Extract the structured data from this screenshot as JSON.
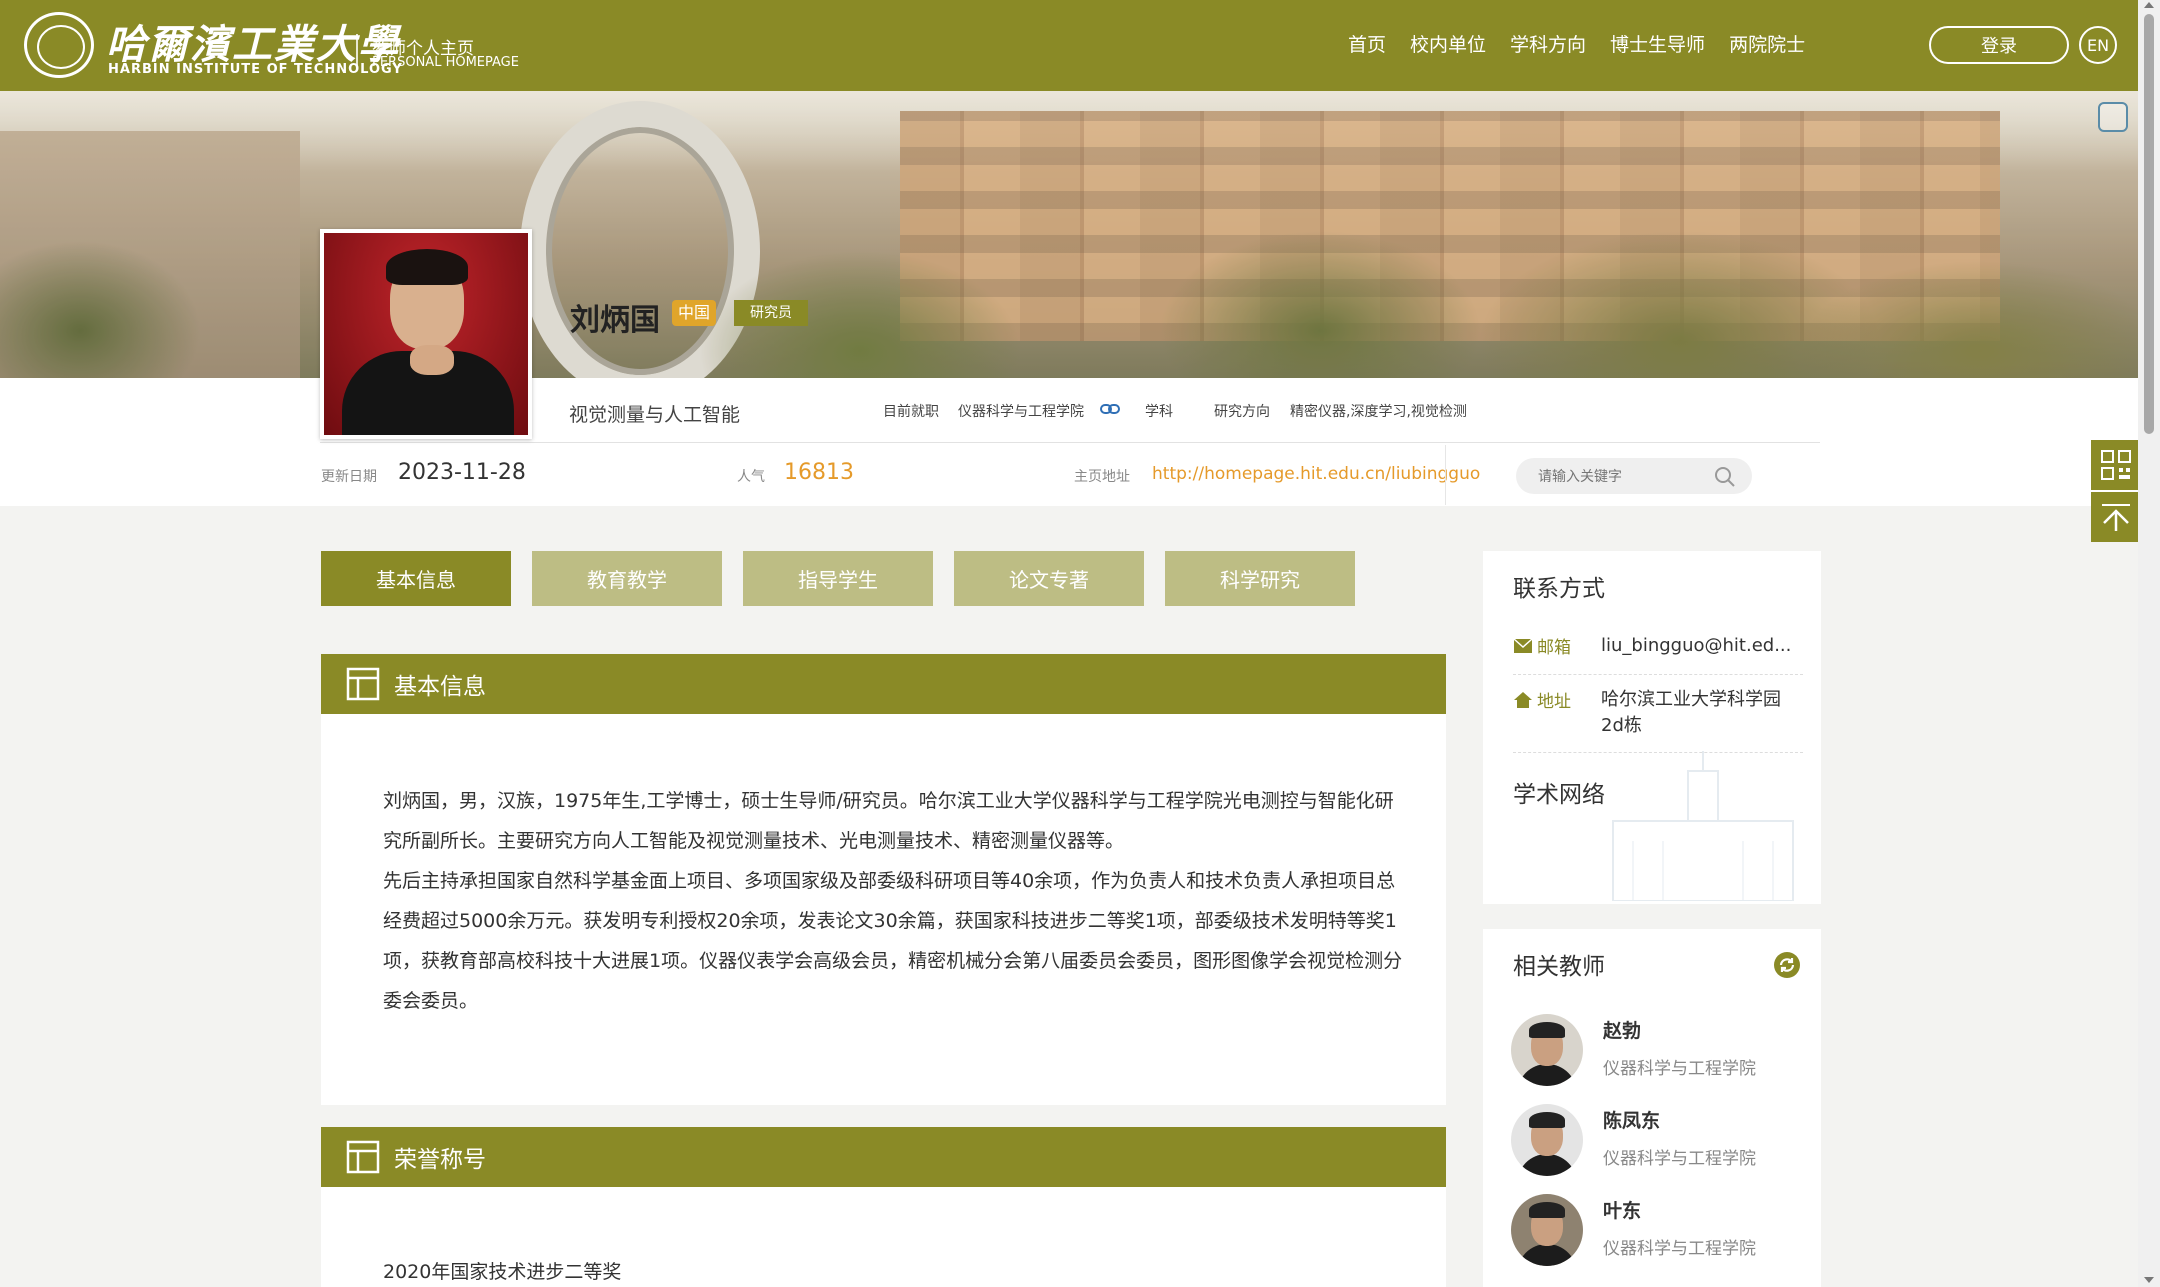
{
  "header": {
    "logo_cn": "哈爾濱工業大學",
    "logo_en": "HARBIN INSTITUTE OF TECHNOLOGY",
    "subtitle_cn": "教师个人主页",
    "subtitle_en": "PERSONAL HOMEPAGE",
    "nav": [
      "首页",
      "校内单位",
      "学科方向",
      "博士生导师",
      "两院院士"
    ],
    "login_label": "登录",
    "lang_label": "EN"
  },
  "profile": {
    "name": "刘炳国",
    "country_tag": "中国",
    "title_tag": "研究员",
    "subtitle": "视觉测量与人工智能",
    "employment_label": "目前就职",
    "employment_value": "仪器科学与工程学院",
    "discipline_label": "学科",
    "discipline_value": "",
    "research_label": "研究方向",
    "research_value": "精密仪器,深度学习,视觉检测",
    "update_label": "更新日期",
    "update_value": "2023-11-28",
    "popularity_label": "人气",
    "popularity_value": "16813",
    "homepage_label": "主页地址",
    "homepage_url": "http://homepage.hit.edu.cn/liubingguo",
    "search_placeholder": "请输入关键字"
  },
  "tabs": [
    "基本信息",
    "教育教学",
    "指导学生",
    "论文专著",
    "科学研究"
  ],
  "active_tab": 0,
  "sections": {
    "basic": {
      "title": "基本信息",
      "paragraphs": [
        "刘炳国，男，汉族，1975年生,工学博士，硕士生导师/研究员。哈尔滨工业大学仪器科学与工程学院光电测控与智能化研究所副所长。主要研究方向人工智能及视觉测量技术、光电测量技术、精密测量仪器等。",
        "先后主持承担国家自然科学基金面上项目、多项国家级及部委级科研项目等40余项，作为负责人和技术负责人承担项目总经费超过5000余万元。获发明专利授权20余项，发表论文30余篇，获国家科技进步二等奖1项，部委级技术发明特等奖1项，获教育部高校科技十大进展1项。仪器仪表学会高级会员，精密机械分会第八届委员会委员，图形图像学会视觉检测分委会委员。"
      ]
    },
    "honors": {
      "title": "荣誉称号",
      "items": [
        "2020年国家技术进步二等奖"
      ]
    }
  },
  "contact": {
    "title": "联系方式",
    "email_label": "邮箱",
    "email_value": "liu_bingguo@hit.ed...",
    "address_label": "地址",
    "address_value": "哈尔滨工业大学科学园2d栋",
    "network_title": "学术网络"
  },
  "related": {
    "title": "相关教师",
    "teachers": [
      {
        "name": "赵勃",
        "dept": "仪器科学与工程学院"
      },
      {
        "name": "陈凤东",
        "dept": "仪器科学与工程学院"
      },
      {
        "name": "叶东",
        "dept": "仪器科学与工程学院"
      }
    ]
  },
  "colors": {
    "brand": "#8a8a26",
    "brand_light": "#bdbd84",
    "accent_orange": "#e59a2a"
  }
}
